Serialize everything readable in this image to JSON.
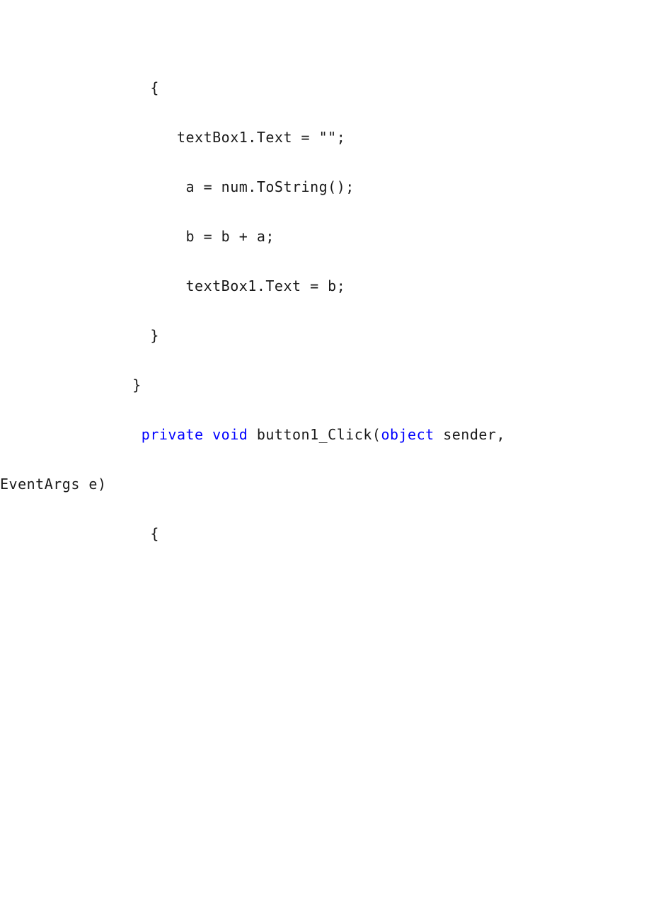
{
  "code": {
    "l1": "        {",
    "l2_a": "           textBox1.Text = ",
    "l2_b": "\"\"",
    "l2_c": ";",
    "l3": "            a = num.ToString();",
    "l4": "",
    "l5": "            b = b + a;",
    "l6": "",
    "l7": "            textBox1.Text = b;",
    "l8": "",
    "l9": "",
    "l10": "        }",
    "l11": "",
    "l12": "",
    "l13": "",
    "l14": "      }",
    "l15": "",
    "l16_indent": "       ",
    "l16_private": "private",
    "l16_sp1": " ",
    "l16_void": "void",
    "l16_btn": " button1_Click(",
    "l16_object": "object",
    "l16_tail": " sender, ",
    "l17": "EventArgs e)",
    "l18": "        {"
  }
}
